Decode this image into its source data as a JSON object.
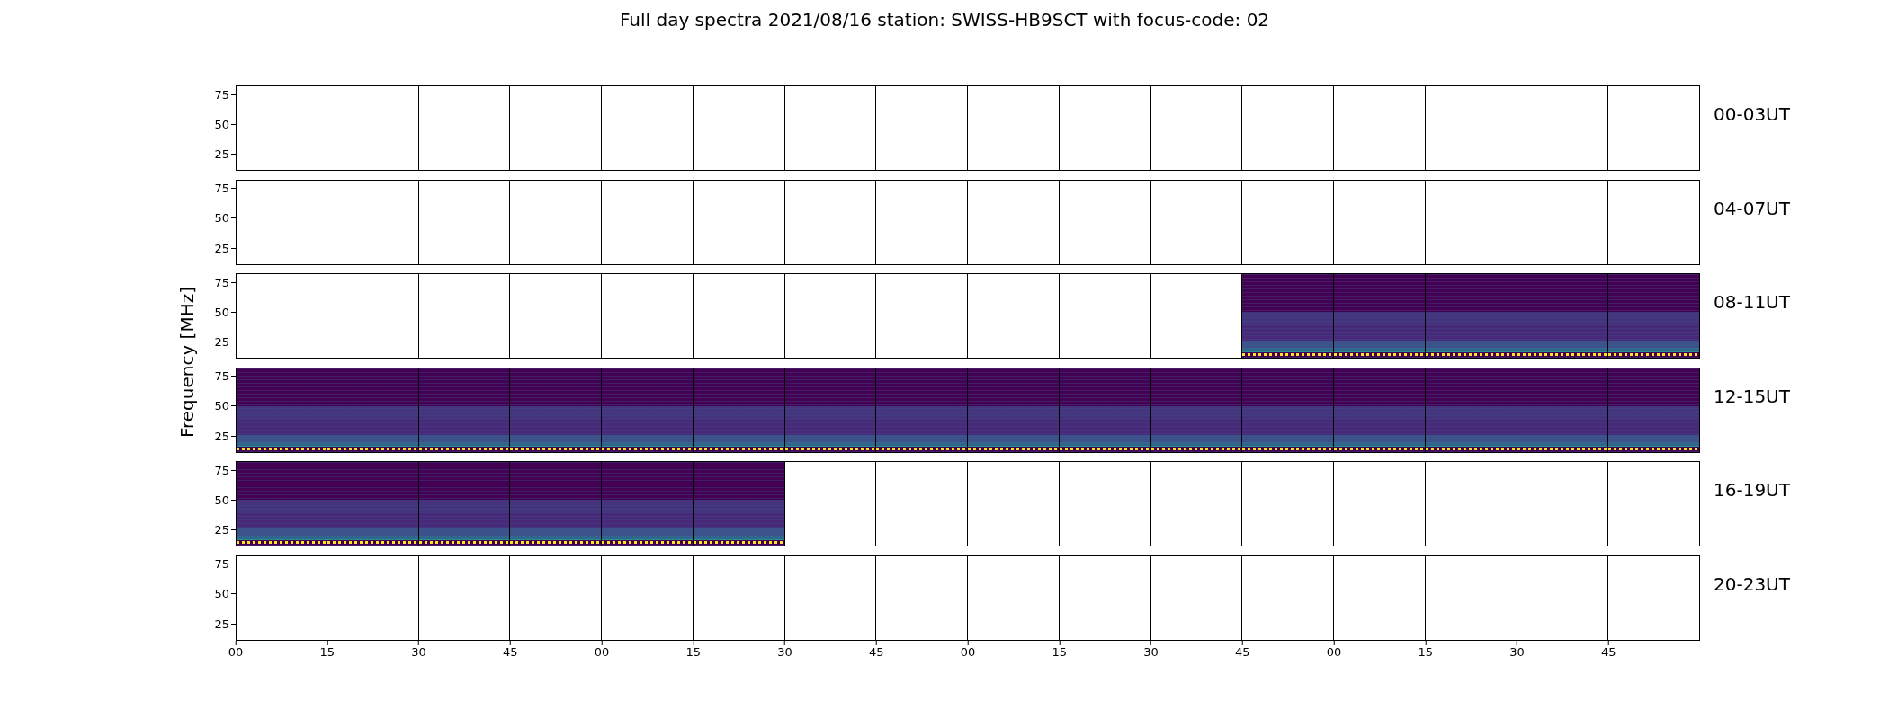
{
  "title": "Full day spectra 2021/08/16 station: SWISS-HB9SCT with focus-code: 02",
  "ylabel": "Frequency [MHz]",
  "rows": [
    {
      "label": "00-03UT",
      "yticks": [
        "75",
        "50",
        "25"
      ],
      "panels": [
        {
          "filled": false
        },
        {
          "filled": false
        },
        {
          "filled": false
        },
        {
          "filled": false
        },
        {
          "filled": false
        },
        {
          "filled": false
        },
        {
          "filled": false
        },
        {
          "filled": false
        },
        {
          "filled": false
        },
        {
          "filled": false
        },
        {
          "filled": false
        },
        {
          "filled": false
        },
        {
          "filled": false
        },
        {
          "filled": false
        },
        {
          "filled": false
        },
        {
          "filled": false
        }
      ]
    },
    {
      "label": "04-07UT",
      "yticks": [
        "75",
        "50",
        "25"
      ],
      "panels": [
        {
          "filled": false
        },
        {
          "filled": false
        },
        {
          "filled": false
        },
        {
          "filled": false
        },
        {
          "filled": false
        },
        {
          "filled": false
        },
        {
          "filled": false
        },
        {
          "filled": false
        },
        {
          "filled": false
        },
        {
          "filled": false
        },
        {
          "filled": false
        },
        {
          "filled": false
        },
        {
          "filled": false
        },
        {
          "filled": false
        },
        {
          "filled": false
        },
        {
          "filled": false
        }
      ]
    },
    {
      "label": "08-11UT",
      "yticks": [
        "75",
        "50",
        "25"
      ],
      "panels": [
        {
          "filled": false
        },
        {
          "filled": false
        },
        {
          "filled": false
        },
        {
          "filled": false
        },
        {
          "filled": false
        },
        {
          "filled": false
        },
        {
          "filled": false
        },
        {
          "filled": false
        },
        {
          "filled": false
        },
        {
          "filled": false
        },
        {
          "filled": false
        },
        {
          "filled": true
        },
        {
          "filled": true
        },
        {
          "filled": true
        },
        {
          "filled": true
        },
        {
          "filled": true
        }
      ]
    },
    {
      "label": "12-15UT",
      "yticks": [
        "75",
        "50",
        "25"
      ],
      "panels": [
        {
          "filled": true
        },
        {
          "filled": true
        },
        {
          "filled": true
        },
        {
          "filled": true
        },
        {
          "filled": true
        },
        {
          "filled": true
        },
        {
          "filled": true
        },
        {
          "filled": true
        },
        {
          "filled": true
        },
        {
          "filled": true
        },
        {
          "filled": true
        },
        {
          "filled": true
        },
        {
          "filled": true
        },
        {
          "filled": true
        },
        {
          "filled": true
        },
        {
          "filled": true
        }
      ]
    },
    {
      "label": "16-19UT",
      "yticks": [
        "75",
        "50",
        "25"
      ],
      "panels": [
        {
          "filled": true
        },
        {
          "filled": true
        },
        {
          "filled": true
        },
        {
          "filled": true
        },
        {
          "filled": true
        },
        {
          "filled": true
        },
        {
          "filled": false
        },
        {
          "filled": false
        },
        {
          "filled": false
        },
        {
          "filled": false
        },
        {
          "filled": false
        },
        {
          "filled": false
        },
        {
          "filled": false
        },
        {
          "filled": false
        },
        {
          "filled": false
        },
        {
          "filled": false
        }
      ]
    },
    {
      "label": "20-23UT",
      "yticks": [
        "75",
        "50",
        "25"
      ],
      "panels": [
        {
          "filled": false
        },
        {
          "filled": false
        },
        {
          "filled": false
        },
        {
          "filled": false
        },
        {
          "filled": false
        },
        {
          "filled": false
        },
        {
          "filled": false
        },
        {
          "filled": false
        },
        {
          "filled": false
        },
        {
          "filled": false
        },
        {
          "filled": false
        },
        {
          "filled": false
        },
        {
          "filled": false
        },
        {
          "filled": false
        },
        {
          "filled": false
        },
        {
          "filled": false
        }
      ]
    }
  ],
  "xticks": [
    "00",
    "15",
    "30",
    "45",
    "00",
    "15",
    "30",
    "45",
    "00",
    "15",
    "30",
    "45",
    "00",
    "15",
    "30",
    "45"
  ]
}
